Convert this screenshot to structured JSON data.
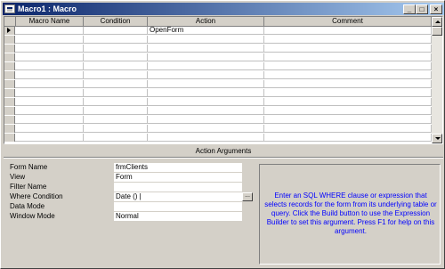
{
  "window": {
    "title": "Macro1 : Macro",
    "buttons": {
      "minimize": "_",
      "maximize": "□",
      "close": "×"
    }
  },
  "grid": {
    "columns": [
      "Macro Name",
      "Condition",
      "Action",
      "Comment"
    ],
    "rows": [
      {
        "macro_name": "",
        "condition": "",
        "action": "OpenForm",
        "comment": ""
      },
      {
        "macro_name": "",
        "condition": "",
        "action": "",
        "comment": ""
      },
      {
        "macro_name": "",
        "condition": "",
        "action": "",
        "comment": ""
      },
      {
        "macro_name": "",
        "condition": "",
        "action": "",
        "comment": ""
      },
      {
        "macro_name": "",
        "condition": "",
        "action": "",
        "comment": ""
      },
      {
        "macro_name": "",
        "condition": "",
        "action": "",
        "comment": ""
      },
      {
        "macro_name": "",
        "condition": "",
        "action": "",
        "comment": ""
      },
      {
        "macro_name": "",
        "condition": "",
        "action": "",
        "comment": ""
      },
      {
        "macro_name": "",
        "condition": "",
        "action": "",
        "comment": ""
      },
      {
        "macro_name": "",
        "condition": "",
        "action": "",
        "comment": ""
      },
      {
        "macro_name": "",
        "condition": "",
        "action": "",
        "comment": ""
      },
      {
        "macro_name": "",
        "condition": "",
        "action": "",
        "comment": ""
      },
      {
        "macro_name": "",
        "condition": "",
        "action": "",
        "comment": ""
      }
    ]
  },
  "action_arguments": {
    "title": "Action Arguments",
    "fields": [
      {
        "label": "Form Name",
        "value": "frmClients"
      },
      {
        "label": "View",
        "value": "Form"
      },
      {
        "label": "Filter Name",
        "value": ""
      },
      {
        "label": "Where Condition",
        "value": "Date () |"
      },
      {
        "label": "Data Mode",
        "value": ""
      },
      {
        "label": "Window Mode",
        "value": "Normal"
      }
    ],
    "build_button": "...",
    "help": "Enter an SQL WHERE clause or expression that selects records for the form from its underlying table or query. Click the Build button to use the Expression Builder to set this argument. Press F1 for help on this argument."
  },
  "colors": {
    "title_start": "#0a246a",
    "title_end": "#a6caf0",
    "help_text": "#0000ff",
    "face": "#d4d0c8"
  }
}
